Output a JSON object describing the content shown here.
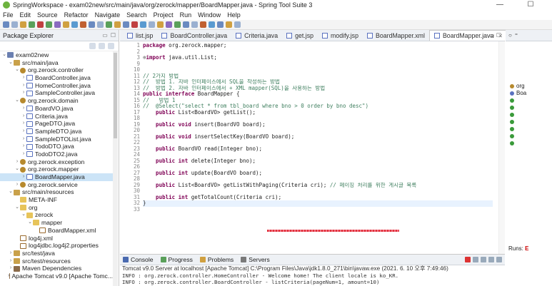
{
  "window": {
    "title": "SpringWorkspace - exam02new/src/main/java/org/zerock/mapper/BoardMapper.java - Spring Tool Suite 3",
    "minimize": "—",
    "maximize": "☐"
  },
  "menu": [
    "File",
    "Edit",
    "Source",
    "Refactor",
    "Navigate",
    "Search",
    "Project",
    "Run",
    "Window",
    "Help"
  ],
  "package_explorer": {
    "title": "Package Explorer",
    "items": [
      {
        "depth": 0,
        "twisty": "⌄",
        "icon": "project-icon",
        "label": "exam02new"
      },
      {
        "depth": 1,
        "twisty": "⌄",
        "icon": "source-folder-icon",
        "label": "src/main/java"
      },
      {
        "depth": 2,
        "twisty": "⌄",
        "icon": "package-icon",
        "label": "org.zerock.controller"
      },
      {
        "depth": 3,
        "twisty": "›",
        "icon": "java-file-icon",
        "label": "BoardController.java"
      },
      {
        "depth": 3,
        "twisty": "›",
        "icon": "java-file-icon",
        "label": "HomeController.java"
      },
      {
        "depth": 3,
        "twisty": "›",
        "icon": "java-file-icon",
        "label": "SampleController.java"
      },
      {
        "depth": 2,
        "twisty": "⌄",
        "icon": "package-icon",
        "label": "org.zerock.domain"
      },
      {
        "depth": 3,
        "twisty": "›",
        "icon": "java-file-icon",
        "label": "BoardVO.java"
      },
      {
        "depth": 3,
        "twisty": "›",
        "icon": "java-file-icon",
        "label": "Criteria.java"
      },
      {
        "depth": 3,
        "twisty": "›",
        "icon": "java-file-icon",
        "label": "PageDTO.java"
      },
      {
        "depth": 3,
        "twisty": "›",
        "icon": "java-file-icon",
        "label": "SampleDTO.java"
      },
      {
        "depth": 3,
        "twisty": "›",
        "icon": "java-file-icon",
        "label": "SampleDTOList.java"
      },
      {
        "depth": 3,
        "twisty": "›",
        "icon": "java-file-icon",
        "label": "TodoDTO.java"
      },
      {
        "depth": 3,
        "twisty": "›",
        "icon": "java-file-icon",
        "label": "TodoDTO2.java"
      },
      {
        "depth": 2,
        "twisty": "›",
        "icon": "package-icon",
        "label": "org.zerock.exception"
      },
      {
        "depth": 2,
        "twisty": "⌄",
        "icon": "package-icon",
        "label": "org.zerock.mapper"
      },
      {
        "depth": 3,
        "twisty": "›",
        "icon": "java-file-icon",
        "label": "BoardMapper.java",
        "selected": true
      },
      {
        "depth": 2,
        "twisty": "›",
        "icon": "package-icon",
        "label": "org.zerock.service"
      },
      {
        "depth": 1,
        "twisty": "⌄",
        "icon": "source-folder-icon",
        "label": "src/main/resources"
      },
      {
        "depth": 2,
        "twisty": "",
        "icon": "folder-icon",
        "label": "META-INF"
      },
      {
        "depth": 2,
        "twisty": "⌄",
        "icon": "folder-icon",
        "label": "org"
      },
      {
        "depth": 3,
        "twisty": "⌄",
        "icon": "folder-icon",
        "label": "zerock"
      },
      {
        "depth": 4,
        "twisty": "⌄",
        "icon": "folder-icon",
        "label": "mapper"
      },
      {
        "depth": 5,
        "twisty": "",
        "icon": "xml-file-icon",
        "label": "BoardMapper.xml"
      },
      {
        "depth": 2,
        "twisty": "",
        "icon": "xml-file-icon",
        "label": "log4j.xml"
      },
      {
        "depth": 2,
        "twisty": "",
        "icon": "properties-file-icon",
        "label": "log4jdbc.log4j2.properties"
      },
      {
        "depth": 1,
        "twisty": "›",
        "icon": "source-folder-icon",
        "label": "src/test/java"
      },
      {
        "depth": 1,
        "twisty": "›",
        "icon": "source-folder-icon",
        "label": "src/test/resources"
      },
      {
        "depth": 1,
        "twisty": "›",
        "icon": "library-icon",
        "label": "Maven Dependencies"
      },
      {
        "depth": 1,
        "twisty": "›",
        "icon": "library-icon",
        "label": "Apache Tomcat v9.0 [Apache Tomc..."
      }
    ]
  },
  "editor": {
    "tabs": [
      {
        "label": "list.jsp",
        "active": false
      },
      {
        "label": "BoardController.java",
        "active": false
      },
      {
        "label": "Criteria.java",
        "active": false
      },
      {
        "label": "get.jsp",
        "active": false
      },
      {
        "label": "modify.jsp",
        "active": false
      },
      {
        "label": "BoardMapper.xml",
        "active": false
      },
      {
        "label": "BoardMapper.java",
        "active": true
      }
    ],
    "close_glyph": "✕",
    "line_numbers": [
      "1",
      "2",
      "3",
      "9",
      "10",
      "11",
      "12",
      "13",
      "14",
      "15",
      "16",
      "17",
      "18",
      "19",
      "20",
      "21",
      "22",
      "23",
      "24",
      "25",
      "26",
      "27",
      "28",
      "29",
      "30",
      "31",
      "32",
      "33"
    ],
    "code": [
      [
        {
          "t": "package",
          "c": "kw"
        },
        {
          "t": " org.zerock.mapper;"
        }
      ],
      [
        {
          "t": ""
        }
      ],
      [
        {
          "t": "⊕",
          "c": "ann"
        },
        {
          "t": "import",
          "c": "kw"
        },
        {
          "t": " java.util.List;"
        }
      ],
      [
        {
          "t": ""
        }
      ],
      [
        {
          "t": ""
        }
      ],
      [
        {
          "t": "// 2가지 방법",
          "c": "cm"
        }
      ],
      [
        {
          "t": "//  방법 1. 자바 인터페이스에서 SQL을 작성하는 방법",
          "c": "cm"
        }
      ],
      [
        {
          "t": "//  방법 2. 자바 인터페이스에서 + XML mapper(SQL)을 사용하는 방법",
          "c": "cm"
        }
      ],
      [
        {
          "t": "public interface",
          "c": "kw"
        },
        {
          "t": " BoardMapper {"
        }
      ],
      [
        {
          "t": "//   방법 1",
          "c": "cm"
        }
      ],
      [
        {
          "t": "//  @Select(\"select * from tbl_board where bno > 0 order by bno desc\")",
          "c": "cm"
        }
      ],
      [
        {
          "t": "    public",
          "c": "kw"
        },
        {
          "t": " List<BoardVO> getList();"
        }
      ],
      [
        {
          "t": ""
        }
      ],
      [
        {
          "t": "    public void",
          "c": "kw"
        },
        {
          "t": " insert(BoardVO board);"
        }
      ],
      [
        {
          "t": ""
        }
      ],
      [
        {
          "t": "    public void",
          "c": "kw"
        },
        {
          "t": " insertSelectKey(BoardVO board);"
        }
      ],
      [
        {
          "t": ""
        }
      ],
      [
        {
          "t": "    public",
          "c": "kw"
        },
        {
          "t": " BoardVO read(Integer bno);"
        }
      ],
      [
        {
          "t": ""
        }
      ],
      [
        {
          "t": "    public int",
          "c": "kw"
        },
        {
          "t": " delete(Integer bno);"
        }
      ],
      [
        {
          "t": ""
        }
      ],
      [
        {
          "t": "    public int",
          "c": "kw"
        },
        {
          "t": " update(BoardVO board);"
        }
      ],
      [
        {
          "t": ""
        }
      ],
      [
        {
          "t": "    public",
          "c": "kw"
        },
        {
          "t": " List<BoardVO> getListWithPaging(Criteria cri); "
        },
        {
          "t": "// 페이징 처리를 위한 게시글 목록",
          "c": "cm"
        }
      ],
      [
        {
          "t": ""
        }
      ],
      [
        {
          "t": "    public int",
          "c": "kw"
        },
        {
          "t": " getTotalCount(Criteria cri);"
        }
      ],
      [
        {
          "t": "}"
        }
      ],
      [
        {
          "t": ""
        }
      ]
    ],
    "highlighted_line": 26
  },
  "console": {
    "tabs": [
      "Console",
      "Progress",
      "Problems",
      "Servers"
    ],
    "header": "Tomcat v9.0 Server at localhost [Apache Tomcat] C:\\Program Files\\Java\\jdk1.8.0_271\\bin\\javaw.exe  (2021. 6. 10 오후 7:49:46)",
    "lines": [
      "INFO : org.zerock.controller.HomeController - Welcome home! The client locale is ko_KR.",
      "INFO : org.zerock.controller.BoardController - listCriteria(pageNum=1, amount=10)"
    ]
  },
  "right_panel": {
    "outline_items": [
      "org",
      "Boa"
    ],
    "runs_label": "Runs:",
    "runs_value": "E"
  },
  "colors": {
    "keyword": "#7f0055",
    "comment": "#3f7f5f",
    "selection": "#cce4f7",
    "current_line": "#e8f2fe",
    "error_underline": "#e0303a"
  }
}
